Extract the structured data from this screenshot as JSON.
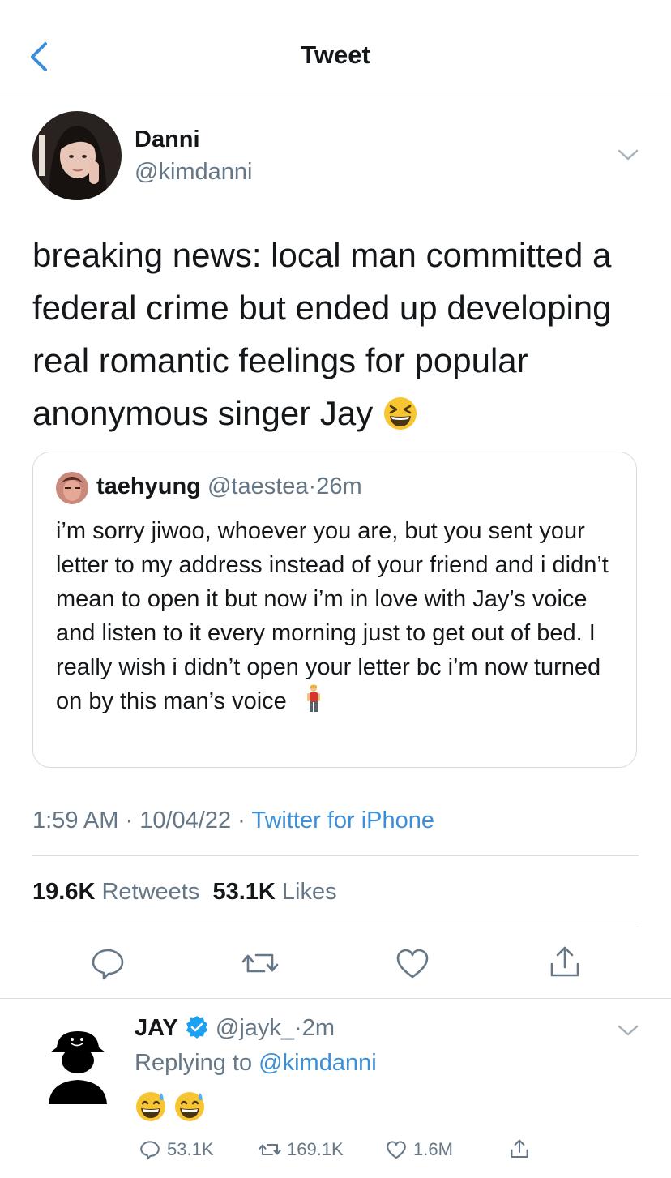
{
  "header": {
    "title": "Tweet"
  },
  "tweet": {
    "author_name": "Danni",
    "author_handle": "@kimdanni",
    "text": "breaking news: local man committed a federal crime but ended up developing real romantic feelings for popular anonymous singer Jay",
    "text_emoji": "grinning-squinting-face",
    "quote": {
      "name": "taehyung",
      "handle": "@taestea",
      "sep": "·",
      "time": "26m",
      "text": "i’m sorry jiwoo, whoever you are, but you sent your letter to my address instead of your friend and i didn’t mean to open it but now i’m in love with Jay’s voice and listen to it every morning just to get out of bed. I really wish i didn’t open your letter bc i’m now turned on by this man’s voice",
      "text_emoji": "man-standing"
    },
    "time": "1:59 AM",
    "sep1": "·",
    "date": "10/04/22",
    "sep2": "·",
    "client": "Twitter for iPhone",
    "retweets_count": "19.6K",
    "retweets_label": "Retweets",
    "likes_count": "53.1K",
    "likes_label": "Likes",
    "actions": [
      "reply-icon",
      "retweet-icon",
      "like-icon",
      "share-icon"
    ]
  },
  "reply": {
    "name": "JAY",
    "verified": true,
    "handle": "@jayk_",
    "sep": "·",
    "time": "2m",
    "replying_prefix": "Replying to",
    "replying_to": "@kimdanni",
    "emojis": [
      "grinning-face-with-sweat",
      "grinning-face-with-sweat"
    ],
    "reply_count": "53.1K",
    "retweet_count": "169.1K",
    "like_count": "1.6M"
  },
  "colors": {
    "link": "#3c8fd6",
    "secondary": "#657786",
    "divider": "#d9dde1",
    "verified": "#1da1f2"
  }
}
